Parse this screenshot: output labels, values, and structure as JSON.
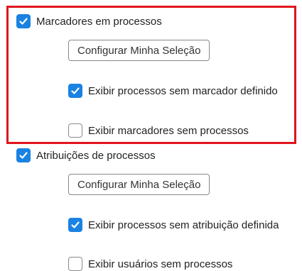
{
  "sections": [
    {
      "header": {
        "label": "Marcadores em processos",
        "checked": true
      },
      "button_label": "Configurar Minha Seleção",
      "options": [
        {
          "label": "Exibir processos sem marcador definido",
          "checked": true
        },
        {
          "label": "Exibir marcadores sem processos",
          "checked": false
        }
      ]
    },
    {
      "header": {
        "label": "Atribuições de processos",
        "checked": true
      },
      "button_label": "Configurar Minha Seleção",
      "options": [
        {
          "label": "Exibir processos sem atribuição definida",
          "checked": true
        },
        {
          "label": "Exibir usuários sem processos",
          "checked": false
        }
      ]
    }
  ],
  "colors": {
    "checkbox_checked": "#1a82e2",
    "highlight_border": "#e0141e"
  }
}
